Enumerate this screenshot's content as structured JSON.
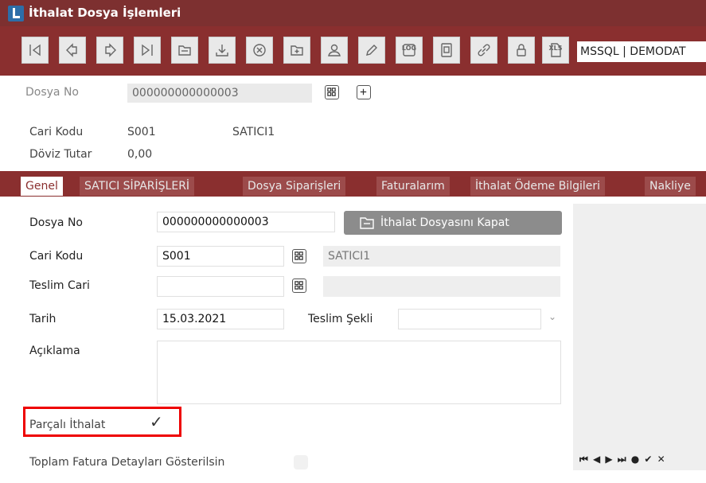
{
  "window": {
    "title": "İthalat Dosya İşlemleri"
  },
  "toolbar": {
    "connection": "MSSQL | DEMODAT",
    "log_label": "LOG",
    "xls_label": "XLS"
  },
  "header": {
    "dosya_no_label": "Dosya No",
    "dosya_no_value": "000000000000003",
    "cari_kodu_label": "Cari Kodu",
    "cari_kodu_value": "S001",
    "cari_name": "SATICI1",
    "doviz_tutar_label": "Döviz Tutar",
    "doviz_tutar_value": "0,00"
  },
  "tabs": [
    {
      "label": "Genel"
    },
    {
      "label": "SATICI SİPARİŞLERİ"
    },
    {
      "label": "Dosya Siparişleri"
    },
    {
      "label": "Faturalarım"
    },
    {
      "label": "İthalat Ödeme Bilgileri"
    },
    {
      "label": "Nakliye"
    }
  ],
  "form": {
    "dosya_no_label": "Dosya No",
    "dosya_no_value": "000000000000003",
    "close_button_label": "İthalat Dosyasını Kapat",
    "cari_kodu_label": "Cari Kodu",
    "cari_kodu_value": "S001",
    "cari_name": "SATICI1",
    "teslim_cari_label": "Teslim Cari",
    "teslim_cari_value": "",
    "tarih_label": "Tarih",
    "tarih_value": "15.03.2021",
    "teslim_sekli_label": "Teslim Şekli",
    "teslim_sekli_value": "",
    "aciklama_label": "Açıklama",
    "aciklama_value": "",
    "parcali_label": "Parçalı İthalat",
    "parcali_checked": true,
    "toplam_label": "Toplam Fatura Detayları Gösterilsin",
    "toplam_checked": false
  },
  "navigator": {
    "buttons": "⏮ ◀ ▶ ⏭ ● ✔ ✕"
  },
  "colors": {
    "accent": "#8a2f2f",
    "highlight": "#e00000"
  }
}
